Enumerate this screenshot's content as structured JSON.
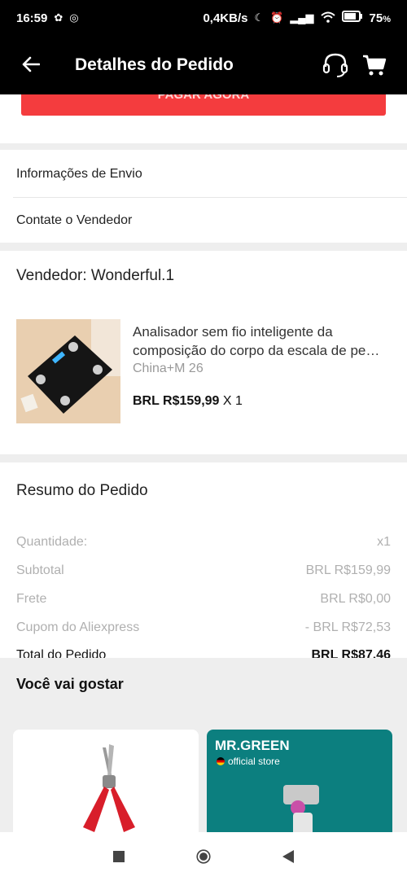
{
  "status_bar": {
    "time": "16:59",
    "net_speed": "0,4KB/s",
    "battery": "75"
  },
  "header": {
    "title": "Detalhes do Pedido",
    "back_icon": "arrow-left-icon",
    "support_icon": "headset-icon",
    "cart_icon": "cart-icon"
  },
  "pay_button": "PAGAR AGORA",
  "links": {
    "shipping": "Informações de Envio",
    "contact_seller": "Contate o Vendedor"
  },
  "seller": {
    "label": "Vendedor: Wonderful.1"
  },
  "product": {
    "name": "Analisador sem fio inteligente da composição do corpo da escala de pe…",
    "variant": "China+M 26",
    "price": "BRL R$159,99",
    "qty": "X 1"
  },
  "summary": {
    "title": "Resumo do Pedido",
    "rows": [
      {
        "label": "Quantidade:",
        "value": "x1"
      },
      {
        "label": "Subtotal",
        "value": "BRL R$159,99"
      },
      {
        "label": "Frete",
        "value": "BRL R$0,00"
      },
      {
        "label": "Cupom do Aliexpress",
        "value": "- BRL R$72,53"
      }
    ],
    "total_label": "Total do Pedido",
    "total_value": "BRL R$87,46"
  },
  "recommendations": {
    "title": "Você vai gostar",
    "card2_brand": "MR.GREEN",
    "card2_store": "official store"
  },
  "colors": {
    "accent_red": "#f43c3e",
    "brand_teal": "#0c7f7f"
  }
}
